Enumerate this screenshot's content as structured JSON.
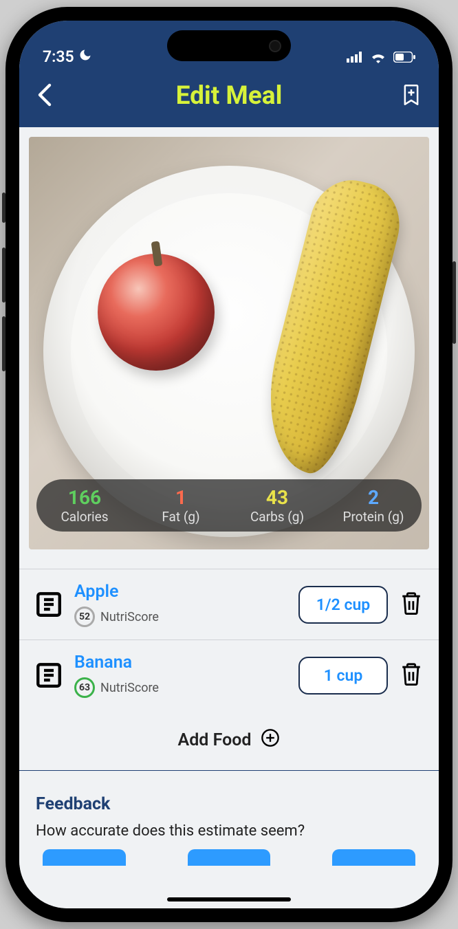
{
  "status": {
    "time": "7:35"
  },
  "header": {
    "title": "Edit Meal"
  },
  "nutrition": {
    "calories": {
      "value": "166",
      "label": "Calories"
    },
    "fat": {
      "value": "1",
      "label": "Fat (g)"
    },
    "carbs": {
      "value": "43",
      "label": "Carbs (g)"
    },
    "protein": {
      "value": "2",
      "label": "Protein (g)"
    }
  },
  "foods": [
    {
      "name": "Apple",
      "score": "52",
      "score_label": "NutriScore",
      "portion": "1/2 cup",
      "score_color": "gray"
    },
    {
      "name": "Banana",
      "score": "63",
      "score_label": "NutriScore",
      "portion": "1 cup",
      "score_color": "green"
    }
  ],
  "add_food": {
    "label": "Add Food"
  },
  "feedback": {
    "title": "Feedback",
    "question": "How accurate does this estimate seem?"
  },
  "colors": {
    "header_bg": "#1f4073",
    "accent_yellow": "#d7f23a",
    "link_blue": "#1e90ff"
  }
}
